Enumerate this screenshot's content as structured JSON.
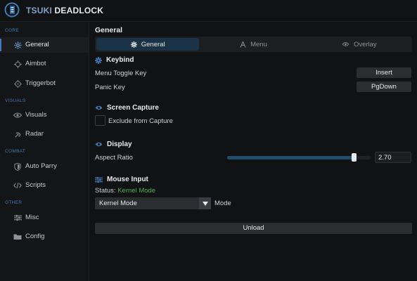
{
  "app": {
    "brand_part1": "TSUKI",
    "brand_part2": "DEADLOCK",
    "accent": "#3f7cb8"
  },
  "sidebar": {
    "sections": [
      "CORE",
      "VISUALS",
      "COMBAT",
      "OTHER"
    ],
    "items": [
      {
        "label": "General",
        "icon": "gear-icon",
        "active": true
      },
      {
        "label": "Aimbot",
        "icon": "crosshair-icon"
      },
      {
        "label": "Triggerbot",
        "icon": "target-icon"
      },
      {
        "label": "Visuals",
        "icon": "eye-icon"
      },
      {
        "label": "Radar",
        "icon": "radar-icon"
      },
      {
        "label": "Auto Parry",
        "icon": "shield-icon"
      },
      {
        "label": "Scripts",
        "icon": "code-icon"
      },
      {
        "label": "Misc",
        "icon": "sliders-icon"
      },
      {
        "label": "Config",
        "icon": "folder-icon"
      }
    ]
  },
  "main": {
    "title": "General",
    "tabs": [
      {
        "label": "General",
        "icon": "gear-icon",
        "active": true
      },
      {
        "label": "Menu",
        "icon": "font-icon"
      },
      {
        "label": "Overlay",
        "icon": "eye-icon"
      }
    ],
    "keybind": {
      "title": "Keybind",
      "menu_toggle_label": "Menu Toggle Key",
      "menu_toggle_value": "Insert",
      "panic_label": "Panic Key",
      "panic_value": "PgDown"
    },
    "screen_capture": {
      "title": "Screen Capture",
      "exclude_label": "Exclude from Capture",
      "exclude_checked": false
    },
    "display": {
      "title": "Display",
      "aspect_label": "Aspect Ratio",
      "aspect_value": "2.70",
      "aspect_fraction": 0.88
    },
    "mouse_input": {
      "title": "Mouse Input",
      "status_label": "Status:",
      "status_value": "Kernel Mode",
      "mode_selected": "Kernel Mode",
      "mode_suffix": "Mode"
    },
    "unload_label": "Unload"
  }
}
